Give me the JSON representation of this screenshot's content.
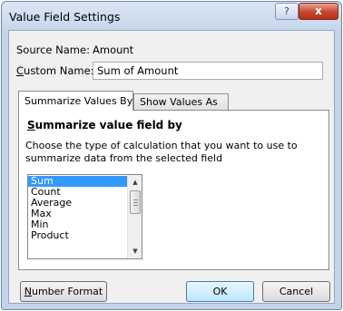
{
  "dialog": {
    "title": "Value Field Settings",
    "help_label": "?",
    "close_label": "x"
  },
  "source": {
    "label": "Source Name:",
    "value": "Amount"
  },
  "custom_name": {
    "label_hotkey": "C",
    "label_rest": "ustom Name:",
    "value": "Sum of Amount"
  },
  "tabs": [
    {
      "label": "Summarize Values By",
      "active": true
    },
    {
      "label": "Show Values As",
      "active": false
    }
  ],
  "summarize": {
    "heading_hotkey": "S",
    "heading_rest": "ummarize value field by",
    "description": "Choose the type of calculation that you want to use to summarize data from the selected field",
    "items": [
      "Sum",
      "Count",
      "Average",
      "Max",
      "Min",
      "Product"
    ],
    "selected": "Sum"
  },
  "scrollbar": {
    "up_icon": "scroll-up-arrow",
    "down_icon": "scroll-down-arrow"
  },
  "buttons": {
    "number_format_hotkey": "N",
    "number_format_rest": "umber Format",
    "ok_label": "OK",
    "cancel_label": "Cancel"
  },
  "colors": {
    "selection": "#3399ff",
    "close_button": "#c8452f",
    "window_frame": "#c3d4e8"
  }
}
